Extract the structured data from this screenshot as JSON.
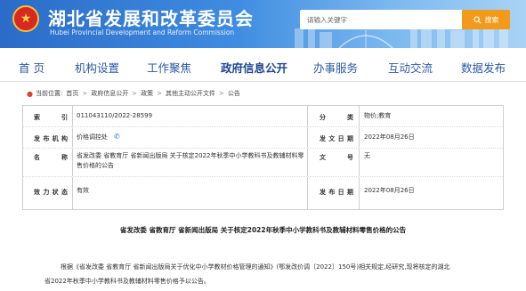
{
  "header": {
    "title": "湖北省发展和改革委员会",
    "subtitle": "Hubei Provincial Development and Reform Commission",
    "search_placeholder": "请输入关键字",
    "search_button": "搜索",
    "emblem_icon": "national-emblem",
    "search_icon": "search-icon"
  },
  "nav": {
    "items": [
      "首 页",
      "机构设置",
      "工作聚焦",
      "政府信息公开",
      "办事服务",
      "互动交流",
      "数据发布"
    ],
    "active": "政府信息公开"
  },
  "breadcrumb": {
    "prefix": "当前位置:",
    "items": [
      "首页",
      "政府信息公开",
      "政策",
      "其他主动公开文件",
      "公告"
    ]
  },
  "info": {
    "index_label": "索　　引",
    "index_value": "011043110/2022-28599",
    "category_label": "分　　类",
    "category_value": "物价;教育",
    "publisher_label": "发布机构",
    "publisher_value": "价格调控处",
    "date_label": "发文日期",
    "date_value": "2022年08月26日",
    "name_label": "名　　称",
    "name_value": "省发改委 省教育厅 省新闻出版局 关于核定2022年秋季中小学教科书及教辅材料零售价格的公告",
    "docno_label": "文　　号",
    "docno_value": "无",
    "status_label": "效力状态",
    "status_value": "有效",
    "pubdate_label": "发布日期",
    "pubdate_value": "2022年08月26日"
  },
  "article": {
    "title": "省发改委 省教育厅 省新闻出版局 关于核定2022年秋季中小学教科书及教辅材料零售价格的公告",
    "para_line1": "根据《省发改委 省教育厅 省新闻出版局关于优化中小学教材价格管理的通知》(鄂发改价调〔2022〕150号)相关规定,经研究,现将核定的湖北",
    "para_line2": "省2022年秋季中小学教科书及教辅材料零售价格予以公告。"
  }
}
